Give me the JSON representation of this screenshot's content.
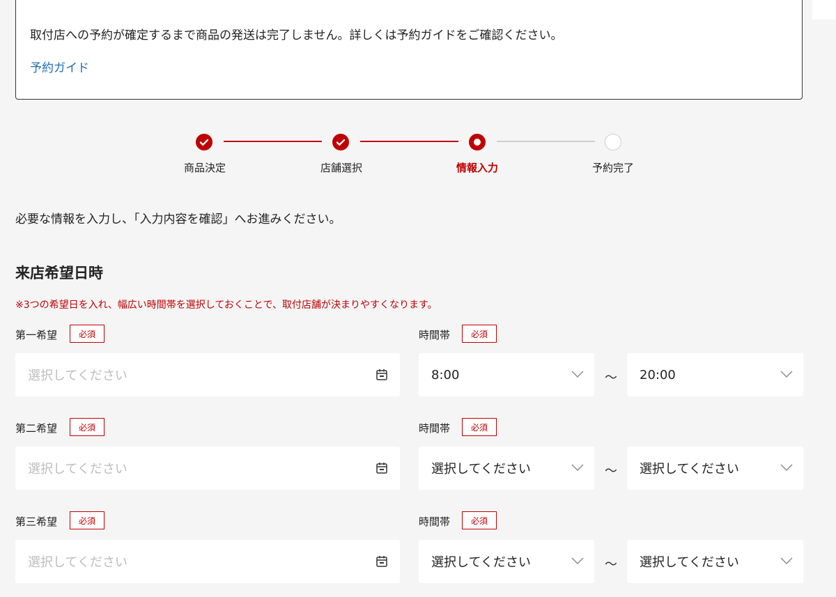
{
  "notice": {
    "text": "取付店への予約が確定するまで商品の発送は完了しません。詳しくは予約ガイドをご確認ください。",
    "link": "予約ガイド"
  },
  "steps": [
    {
      "label": "商品決定",
      "state": "done"
    },
    {
      "label": "店舗選択",
      "state": "done"
    },
    {
      "label": "情報入力",
      "state": "current"
    },
    {
      "label": "予約完了",
      "state": "todo"
    }
  ],
  "intro": "必要な情報を入力し、「入力内容を確認」へお進みください。",
  "section": {
    "title": "来店希望日時",
    "hint": "※3つの希望日を入れ、幅広い時間帯を選択しておくことで、取付店舗が決まりやすくなります。"
  },
  "required_badge": "必須",
  "time_label": "時間帯",
  "tilde": "～",
  "rows": [
    {
      "label": "第一希望",
      "date_placeholder": "選択してください",
      "start": "8:00",
      "end": "20:00"
    },
    {
      "label": "第二希望",
      "date_placeholder": "選択してください",
      "start": "選択してください",
      "end": "選択してください"
    },
    {
      "label": "第三希望",
      "date_placeholder": "選択してください",
      "start": "選択してください",
      "end": "選択してください"
    }
  ],
  "colors": {
    "accent": "#bf0000",
    "link": "#1f6fb2",
    "placeholder": "#bdbdbd"
  },
  "icons": {
    "date": "calendar-icon",
    "select": "chevron-down-icon",
    "done": "check-icon"
  }
}
